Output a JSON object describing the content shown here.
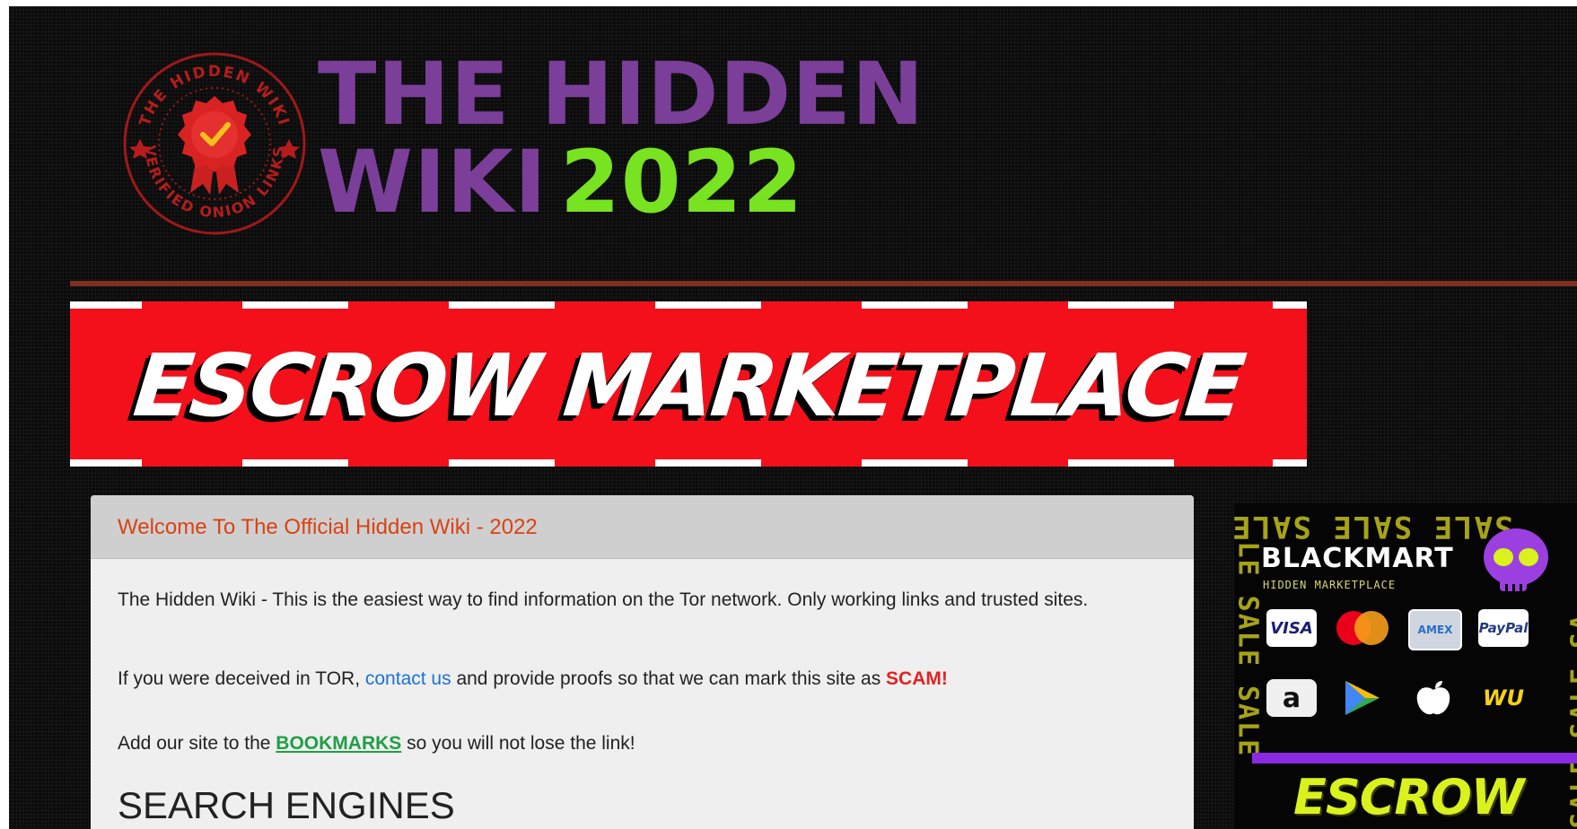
{
  "header": {
    "seal_text_top": "THE HIDDEN WIKI",
    "seal_text_bottom": "VERIFIED ONION LINKS",
    "title_line1": "THE HIDDEN",
    "title_line2": "WIKI",
    "title_year": "2022"
  },
  "banner": {
    "text": "ESCROW MARKETPLACE"
  },
  "panel": {
    "title": "Welcome To The Official Hidden Wiki - 2022",
    "intro": "The Hidden Wiki - This is the easiest way to find information on the Tor network. Only working links and trusted sites.",
    "deceived_prefix": "If you were deceived in TOR,",
    "contact_link": "contact us",
    "deceived_suffix": "and provide proofs so that we can mark this site as",
    "scam_label": "SCAM!",
    "bookmark_prefix": "Add our site to the",
    "bookmark_link": "BOOKMARKS",
    "bookmark_suffix": "so you will not lose the link!",
    "section_heading": "SEARCH ENGINES"
  },
  "ad": {
    "sale_top": "SALE SALE SALE",
    "sale_left": "LE SALE SALE",
    "sale_right": "SALE SALE SA",
    "brand": "BLACKMART",
    "subtitle": "HIDDEN MARKETPLACE",
    "payments_row1": [
      "VISA",
      "AMEX",
      "PayPal"
    ],
    "payments_row2": [
      "a",
      "WU"
    ],
    "escrow": "ESCROW"
  },
  "colors": {
    "title_purple": "#7b3f9a",
    "title_green": "#78e321",
    "banner_red": "#f3101a",
    "panel_title": "#d84315",
    "link_blue": "#1a73d9",
    "scam_red": "#e32222",
    "bookmark_green": "#1f9e44",
    "ad_yellow": "#d9f21e"
  }
}
